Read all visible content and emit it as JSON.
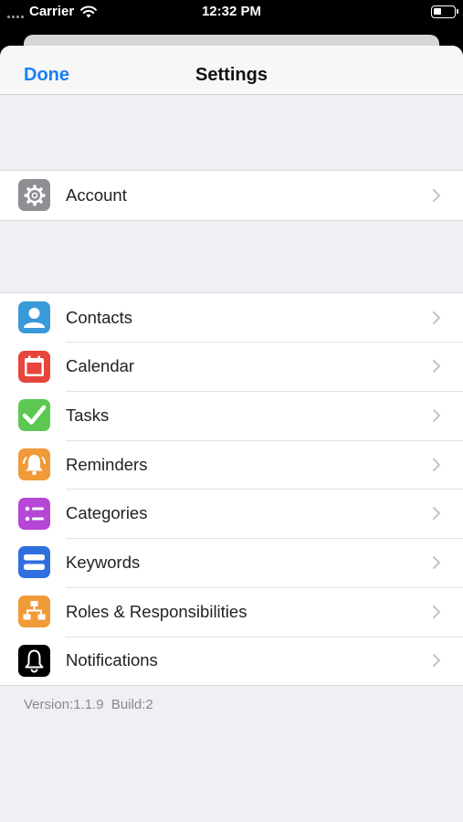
{
  "status_bar": {
    "carrier": "Carrier",
    "time": "12:32 PM"
  },
  "nav": {
    "done_label": "Done",
    "title": "Settings"
  },
  "account_section": [
    {
      "label": "Account",
      "icon": "gear-icon",
      "color": "#8e8e93"
    }
  ],
  "modules_section": [
    {
      "label": "Contacts",
      "icon": "person-icon",
      "color": "#3a9ad9"
    },
    {
      "label": "Calendar",
      "icon": "calendar-icon",
      "color": "#e8453c"
    },
    {
      "label": "Tasks",
      "icon": "checkmark-icon",
      "color": "#5cc852"
    },
    {
      "label": "Reminders",
      "icon": "alarm-bell-icon",
      "color": "#f19a38"
    },
    {
      "label": "Categories",
      "icon": "list-icon",
      "color": "#b546d6"
    },
    {
      "label": "Keywords",
      "icon": "bars-icon",
      "color": "#2f6fe0"
    },
    {
      "label": "Roles & Responsibilities",
      "icon": "org-chart-icon",
      "color": "#f19a38"
    },
    {
      "label": "Notifications",
      "icon": "bell-icon",
      "color": "#000000"
    }
  ],
  "footer": {
    "version": "Version:1.1.9",
    "build": "Build:2"
  }
}
